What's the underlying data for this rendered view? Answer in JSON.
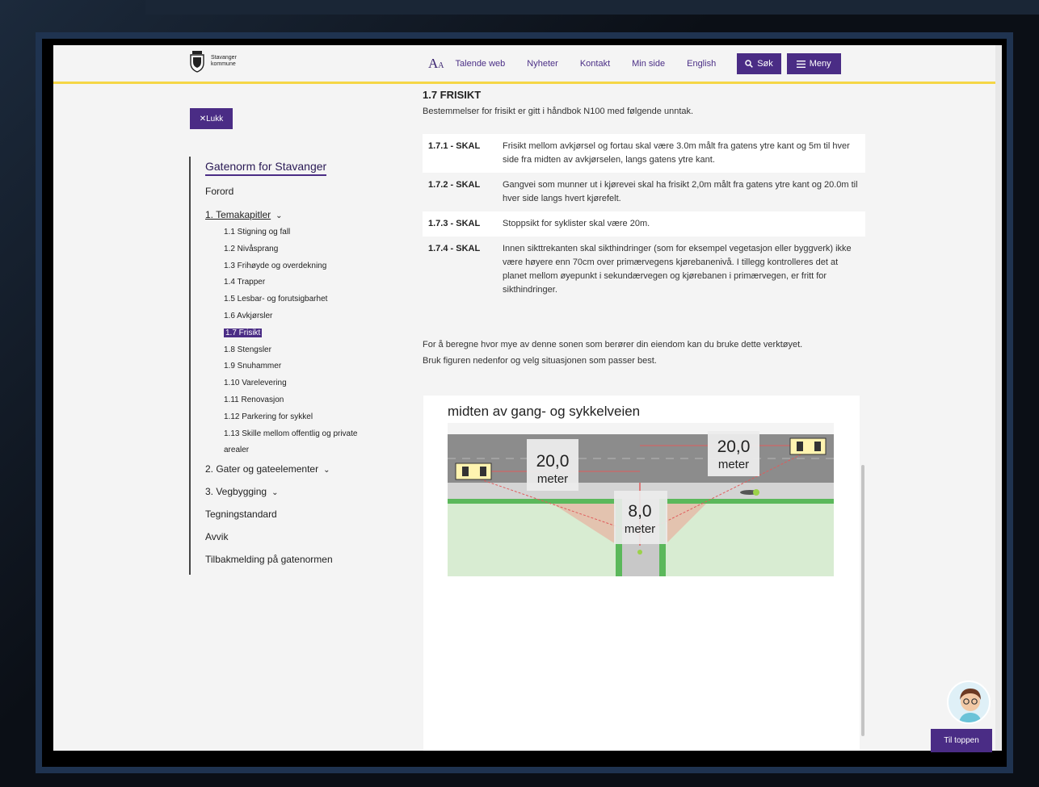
{
  "header": {
    "logo_line1": "Stavanger",
    "logo_line2": "kommune",
    "font_size_label": "A",
    "font_size_small": "A",
    "nav": [
      "Talende web",
      "Nyheter",
      "Kontakt",
      "Min side",
      "English"
    ],
    "search_label": "Søk",
    "menu_label": "Meny"
  },
  "close_label": "✕Lukk",
  "sidebar": {
    "title": "Gatenorm for Stavanger",
    "forord": "Forord",
    "section1": "1. Temakapitler",
    "items": [
      "1.1 Stigning og fall",
      "1.2 Nivåsprang",
      "1.3 Frihøyde og overdekning",
      "1.4 Trapper",
      "1.5 Lesbar- og forutsigbarhet",
      "1.6 Avkjørsler",
      "1.7 Frisikt",
      "1.8 Stengsler",
      "1.9 Snuhammer",
      "1.10 Varelevering",
      "1.11 Renovasjon",
      "1.12 Parkering for sykkel",
      "1.13 Skille mellom offentlig og private",
      "arealer"
    ],
    "section2": "2. Gater og gateelementer",
    "section3": "3. Vegbygging",
    "tegning": "Tegningstandard",
    "avvik": "Avvik",
    "tilbake": "Tilbakmelding på gatenormen"
  },
  "main": {
    "heading": "1.7 FRISIKT",
    "intro": "Bestemmelser for frisikt er gitt i håndbok N100 med følgende unntak.",
    "rules": [
      {
        "code": "1.7.1 - SKAL",
        "text": "Frisikt mellom avkjørsel og fortau skal være 3.0m målt fra gatens ytre kant og 5m  til hver side fra midten av avkjørselen, langs gatens ytre kant."
      },
      {
        "code": "1.7.2 - SKAL",
        "text": "Gangvei som munner ut i kjørevei skal ha frisikt 2,0m målt fra gatens ytre kant og 20.0m til hver side langs hvert kjørefelt."
      },
      {
        "code": "1.7.3 - SKAL",
        "text": "Stoppsikt for syklister skal være 20m."
      },
      {
        "code": "1.7.4 - SKAL",
        "text": "Innen sikttrekanten skal sikthindringer (som for eksempel vegetasjon eller byggverk) ikke være høyere enn 70cm over primærvegens kjørebanenivå. I tillegg kontrolleres det at planet mellom øyepunkt i sekundærvegen og kjørebanen i primærvegen, er fritt for sikthindringer."
      }
    ],
    "calc_line1": "For å beregne hvor mye av denne sonen som berører din eiendom kan du bruke dette verktøyet.",
    "calc_line2": "Bruk figuren nedenfor og velg situasjonen som passer best."
  },
  "figure": {
    "caption": "midten av gang- og sykkelveien",
    "label_left_value": "20,0",
    "label_left_unit": "meter",
    "label_right_value": "20,0",
    "label_right_unit": "meter",
    "label_center_value": "8,0",
    "label_center_unit": "meter"
  },
  "til_toppen": "Til toppen"
}
